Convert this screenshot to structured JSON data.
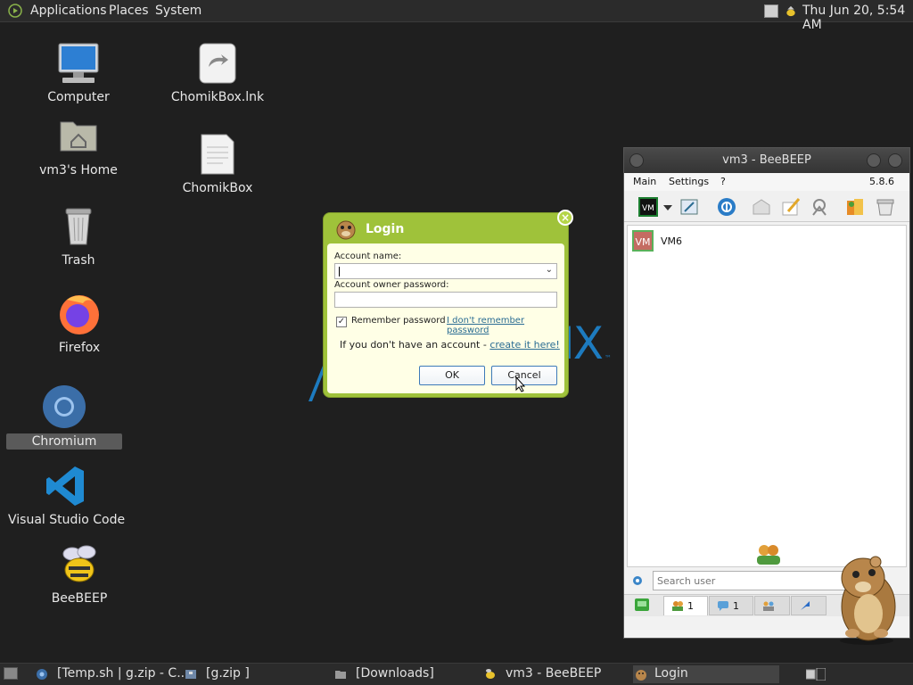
{
  "top_panel": {
    "menus": [
      "Applications",
      "Places",
      "System"
    ],
    "clock": "Thu Jun 20, 5:54 AM"
  },
  "desktop": {
    "icons": [
      {
        "label": "Computer",
        "icon": "computer-icon"
      },
      {
        "label": "vm3's Home",
        "icon": "home-folder-icon"
      },
      {
        "label": "Trash",
        "icon": "trash-icon"
      },
      {
        "label": "Firefox",
        "icon": "firefox-icon"
      },
      {
        "label": "Chromium",
        "icon": "chromium-icon"
      },
      {
        "label": "Visual Studio Code",
        "icon": "vscode-icon"
      },
      {
        "label": "BeeBEEP",
        "icon": "beebeep-icon"
      },
      {
        "label": "ChomikBox.lnk",
        "icon": "shortcut-file-icon"
      },
      {
        "label": "ChomikBox",
        "icon": "text-file-icon"
      }
    ],
    "background_logo_text": "IX",
    "background_logo_tm": "™"
  },
  "login_dialog": {
    "title": "Login",
    "account_name_label": "Account name:",
    "account_name_value": "",
    "password_label": "Account owner password:",
    "password_value": "",
    "remember_label": "Remember password",
    "remember_checked": true,
    "forget_link": "I don't remember password",
    "no_account_text": "If you don't have an account - ",
    "create_link": "create it here!",
    "ok_label": "OK",
    "cancel_label": "Cancel",
    "accent_color": "#9fc23a"
  },
  "beebeep": {
    "title": "vm3 - BeeBEEP",
    "menus": [
      "Main",
      "Settings",
      "?"
    ],
    "version": "5.8.6",
    "users": [
      {
        "avatar": "VM",
        "name": "VM6"
      }
    ],
    "search_placeholder": "Search user",
    "tabs": [
      {
        "icon": "users-icon",
        "count": "1"
      },
      {
        "icon": "chat-icon",
        "count": "1"
      },
      {
        "icon": "groups-icon",
        "count": ""
      },
      {
        "icon": "share-icon",
        "count": ""
      }
    ]
  },
  "taskbar": {
    "tasks": [
      {
        "label": "[Temp.sh | g.zip - C...",
        "icon": "chromium-icon"
      },
      {
        "label": "[g.zip ]",
        "icon": "archive-icon"
      },
      {
        "label": "[Downloads]",
        "icon": "folder-icon"
      },
      {
        "label": "vm3 - BeeBEEP",
        "icon": "beebeep-icon"
      },
      {
        "label": "Login",
        "icon": "beebeep-login-icon"
      }
    ]
  }
}
